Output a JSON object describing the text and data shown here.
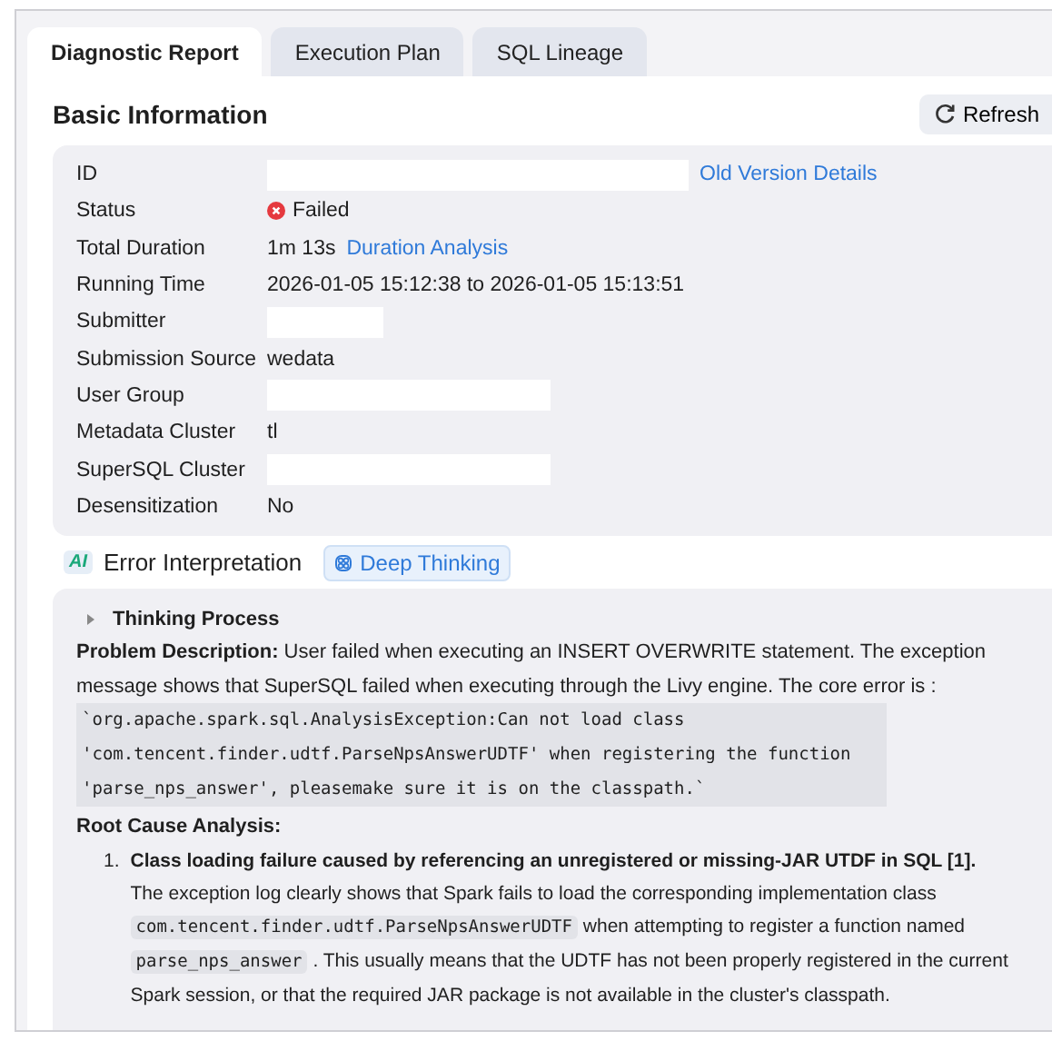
{
  "tabs": [
    {
      "label": "Diagnostic Report",
      "selected": true
    },
    {
      "label": "Execution Plan",
      "selected": false
    },
    {
      "label": "SQL Lineage",
      "selected": false
    }
  ],
  "basic_information": {
    "title": "Basic Information",
    "refresh_button": "Refresh",
    "rows": [
      {
        "label": "ID",
        "kind": "redacted",
        "link": "Old Version Details"
      },
      {
        "label": "Status",
        "kind": "status",
        "value": "Failed"
      },
      {
        "label": "Total Duration",
        "kind": "text",
        "value": "1m 13s",
        "link": "Duration Analysis"
      },
      {
        "label": "Running Time",
        "kind": "text",
        "value": "2026-01-05 15:12:38 to 2026-01-05 15:13:51"
      },
      {
        "label": "Submitter",
        "kind": "redacted"
      },
      {
        "label": "Submission Source",
        "kind": "text",
        "value": "wedata"
      },
      {
        "label": "User Group",
        "kind": "redacted"
      },
      {
        "label": "Metadata Cluster",
        "kind": "text",
        "value": "tl"
      },
      {
        "label": "SuperSQL Cluster",
        "kind": "redacted"
      },
      {
        "label": "Desensitization",
        "kind": "text",
        "value": "No"
      }
    ]
  },
  "error_interpretation": {
    "ai_badge": "AI",
    "title": "Error Interpretation",
    "deep_thinking_button": "Deep Thinking",
    "thinking_process": {
      "label": "Thinking Process",
      "expanded": false
    },
    "problem_description": "**Problem Description:** User failed when executing an INSERT OVERWRITE statement. The exception message shows that SuperSQL failed when executing through the Livy engine. The core error is :",
    "core_error": "`org.apache.spark.sql.AnalysisException:Can not load class 'com.tencent.finder.udtf.ParseNpsAnswerUDTF' when registering the function 'parse_nps_answer', pleasemake sure it is on the classpath.`",
    "root_cause_heading": "Root Cause Analysis:",
    "root_causes": [
      {
        "number": "1.",
        "title": "Class loading failure caused by referencing an unregistered or missing-JAR UTDF in SQL [1].",
        "body": [
          {
            "kind": "text",
            "text": "The exception log clearly shows that Spark fails to load the corresponding implementation class "
          },
          {
            "kind": "code",
            "text": "com.tencent.finder.udtf.ParseNpsAnswerUDTF"
          },
          {
            "kind": "text",
            "text": " when attempting to register a function named "
          },
          {
            "kind": "code",
            "text": "parse_nps_answer"
          },
          {
            "kind": "text",
            "text": " . This usually means that the UDTF has not been properly registered in the current Spark session, or that the required JAR package is not available in the cluster's classpath."
          }
        ]
      }
    ]
  }
}
